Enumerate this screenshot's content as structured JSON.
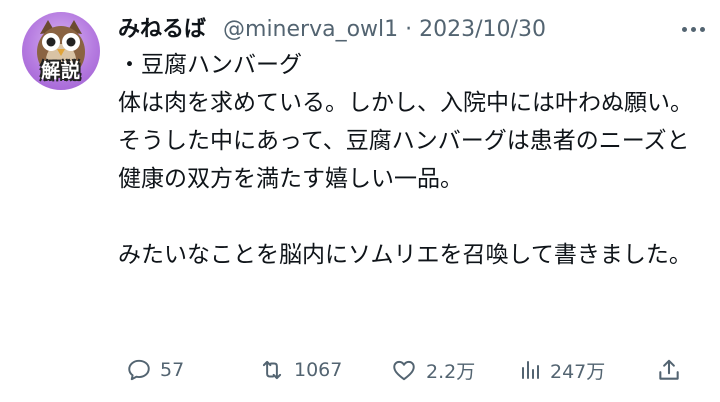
{
  "author": {
    "display_name": "みねるば",
    "handle": "@minerva_owl1",
    "separator": "·",
    "date": "2023/10/30",
    "avatar_badge": "解説"
  },
  "tweet": {
    "lines": [
      "・豆腐ハンバーグ",
      "体は肉を求めている。しかし、入院中には叶わぬ願い。そうした中にあって、豆腐ハンバーグは患者のニーズと健康の双方を満たす嬉しい一品。",
      "",
      "みたいなことを脳内にソムリエを召喚して書きました。"
    ]
  },
  "actions": {
    "replies": "57",
    "retweets": "1067",
    "likes": "2.2万",
    "views": "247万"
  },
  "icons": {
    "reply": "speech-bubble-icon",
    "retweet": "retweet-arrows-icon",
    "like": "heart-icon",
    "views": "bar-chart-icon",
    "share": "share-upload-icon",
    "more": "more-dots-icon"
  },
  "colors": {
    "text": "#0f1419",
    "muted": "#536471",
    "avatar_bg": "#b57be0"
  }
}
